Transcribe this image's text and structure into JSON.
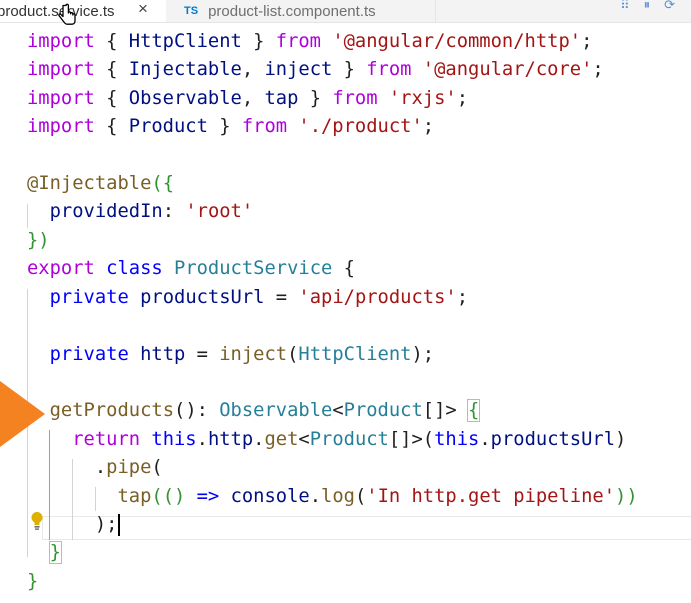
{
  "tabs": [
    {
      "label": "product.service.ts",
      "close_glyph": "×",
      "active": true
    },
    {
      "badge": "TS",
      "label": "product-list.component.ts",
      "active": false
    }
  ],
  "tab_actions": [
    "⠿",
    "⏸",
    "⟳"
  ],
  "colors": {
    "keyword": "#0000ff",
    "control_keyword": "#af00db",
    "string": "#a31515",
    "type": "#267f99",
    "function": "#795e26",
    "property": "#001080",
    "marker": "#f58220",
    "lightbulb": "#ddb100"
  },
  "code": {
    "l1": {
      "t0": "import",
      "t1": " { ",
      "t2": "HttpClient",
      "t3": " } ",
      "t4": "from",
      "t5": " ",
      "t6": "'@angular/common/http'",
      "t7": ";"
    },
    "l2": {
      "t0": "import",
      "t1": " { ",
      "t2": "Injectable",
      "t3": ", ",
      "t4": "inject",
      "t5": " } ",
      "t6": "from",
      "t7": " ",
      "t8": "'@angular/core'",
      "t9": ";"
    },
    "l3": {
      "t0": "import",
      "t1": " { ",
      "t2": "Observable",
      "t3": ", ",
      "t4": "tap",
      "t5": " } ",
      "t6": "from",
      "t7": " ",
      "t8": "'rxjs'",
      "t9": ";"
    },
    "l4": {
      "t0": "import",
      "t1": " { ",
      "t2": "Product",
      "t3": " } ",
      "t4": "from",
      "t5": " ",
      "t6": "'./product'",
      "t7": ";"
    },
    "l6": {
      "t0": "@",
      "t1": "Injectable",
      "t2": "({"
    },
    "l7": {
      "t0": "  ",
      "t1": "providedIn",
      "t2": ": ",
      "t3": "'root'"
    },
    "l8": {
      "t0": "})"
    },
    "l9": {
      "t0": "export",
      "t1": " ",
      "t2": "class",
      "t3": " ",
      "t4": "ProductService",
      "t5": " {"
    },
    "l10": {
      "t0": "  ",
      "t1": "private",
      "t2": " ",
      "t3": "productsUrl",
      "t4": " = ",
      "t5": "'api/products'",
      "t6": ";"
    },
    "l12": {
      "t0": "  ",
      "t1": "private",
      "t2": " ",
      "t3": "http",
      "t4": " = ",
      "t5": "inject",
      "t6": "(",
      "t7": "HttpClient",
      "t8": ");"
    },
    "l14": {
      "t0": "  ",
      "t1": "getProducts",
      "t2": "(): ",
      "t3": "Observable",
      "t4": "<",
      "t5": "Product",
      "t6": "[]> ",
      "t7": "{"
    },
    "l15": {
      "t0": "    ",
      "t1": "return",
      "t2": " ",
      "t3": "this",
      "t4": ".",
      "t5": "http",
      "t6": ".",
      "t7": "get",
      "t8": "<",
      "t9": "Product",
      "t10": "[]>(",
      "t11": "this",
      "t12": ".",
      "t13": "productsUrl",
      "t14": ")"
    },
    "l16": {
      "t0": "      .",
      "t1": "pipe",
      "t2": "("
    },
    "l17": {
      "t0": "        ",
      "t1": "tap",
      "t2": "(() ",
      "t3": "=>",
      "t4": " ",
      "t5": "console",
      "t6": ".",
      "t7": "log",
      "t8": "(",
      "t9": "'In http.get pipeline'",
      "t10": "))"
    },
    "l18": {
      "t0": "      );"
    },
    "l19": {
      "t0": "  ",
      "t1": "}"
    },
    "l20": {
      "t0": "}"
    }
  }
}
